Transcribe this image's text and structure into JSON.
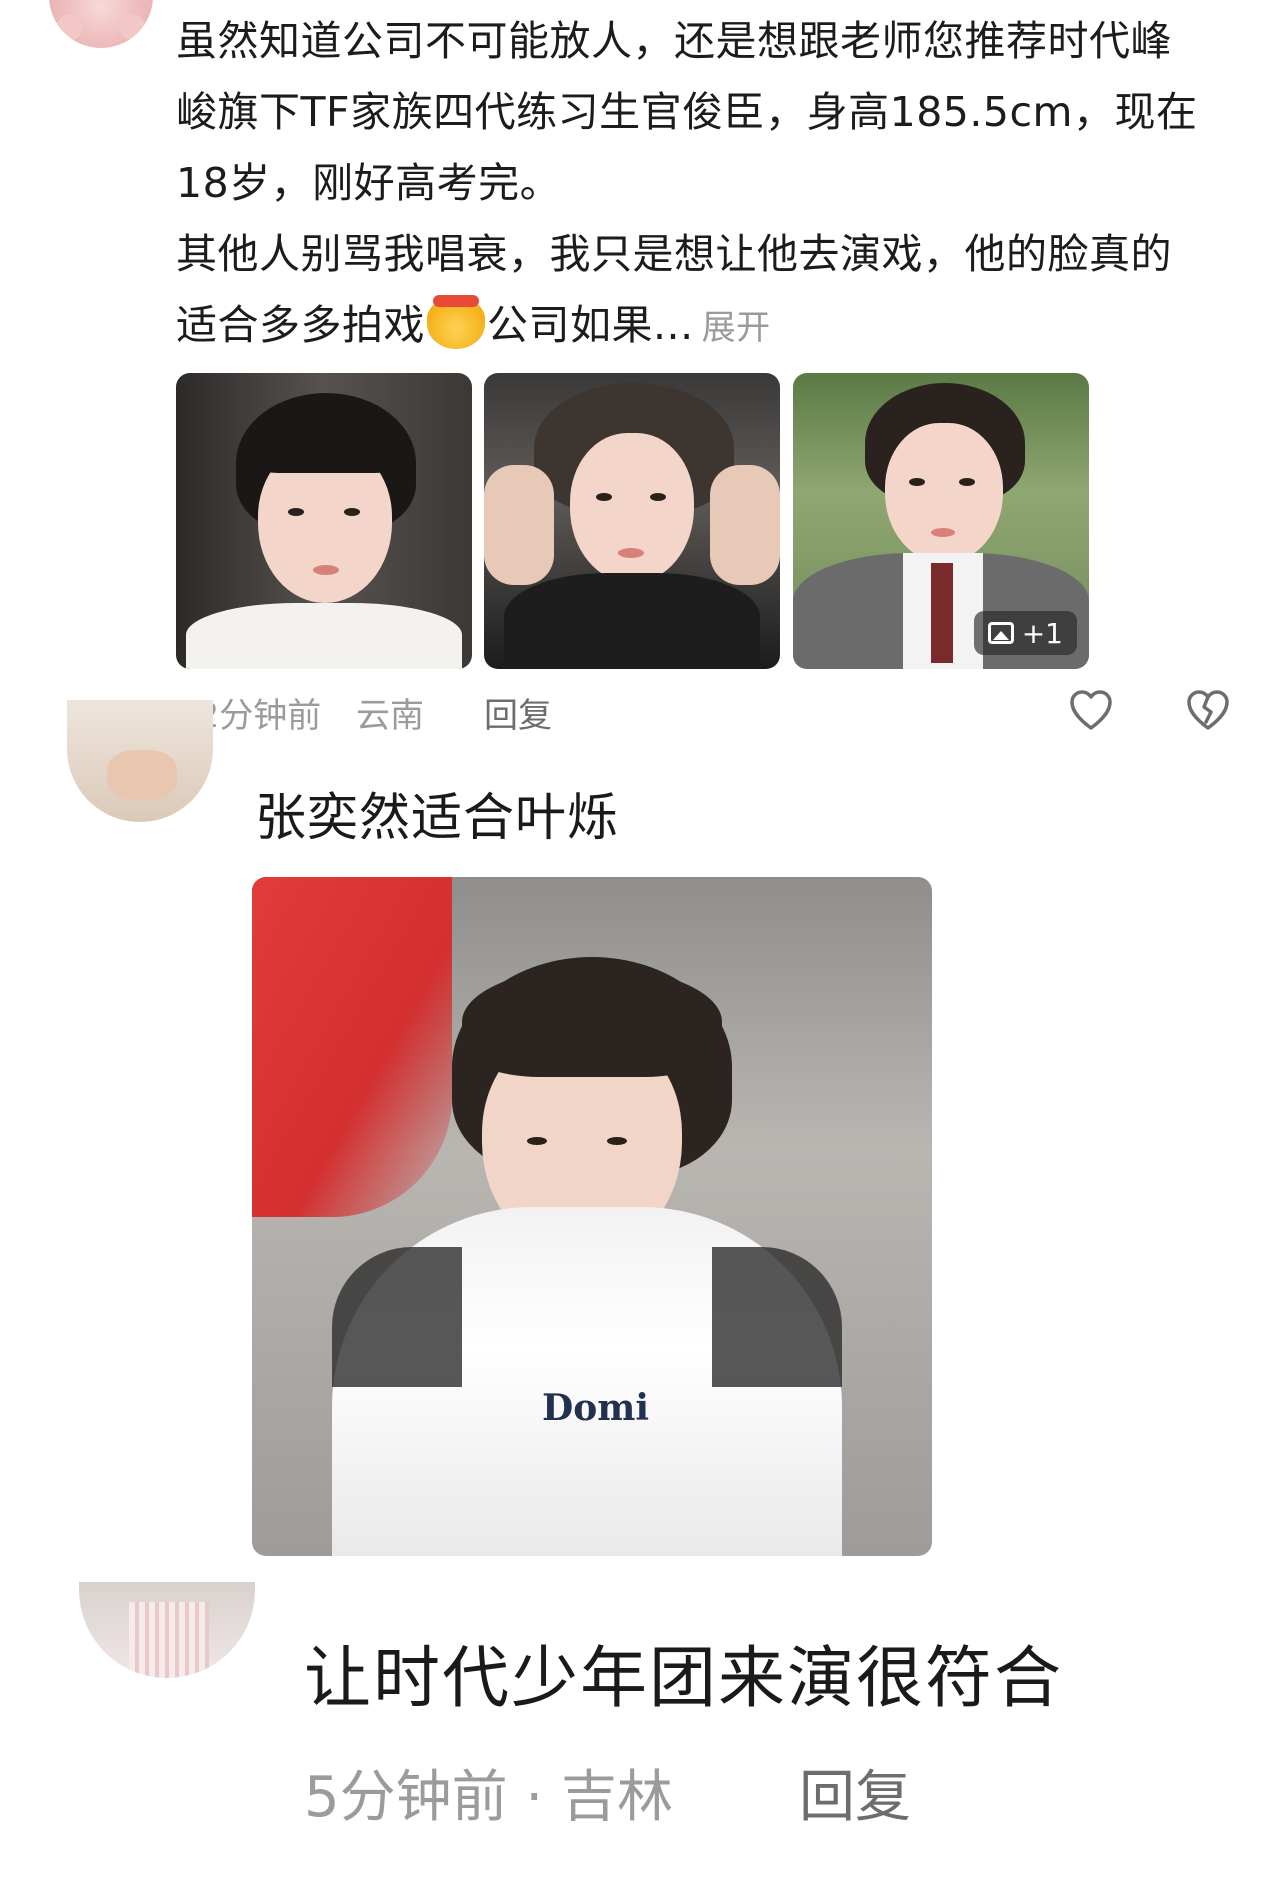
{
  "comment1": {
    "text_line1": "虽然知道公司不可能放人，还是想跟老师您推荐时代峰",
    "text_line2": "峻旗下TF家族四代练习生官俊臣，身高185.5cm，现在",
    "text_line3": "18岁，刚好高考完。",
    "text_line4": "其他人别骂我唱衰，我只是想让他去演戏，他的脸真的",
    "text_line5a": "适合多多拍戏",
    "text_line5b": "公司如果...",
    "expand": "展开",
    "more_images": "+1",
    "time": "32分钟前",
    "place": "云南",
    "reply": "回复"
  },
  "comment2": {
    "text": "张奕然适合叶烁",
    "jersey_text": "Domi"
  },
  "comment3": {
    "text": "让时代少年团来演很符合",
    "meta": "5分钟前 · 吉林",
    "reply": "回复"
  },
  "icons": {
    "like": "heart-icon",
    "dislike": "broken-heart-icon",
    "gallery": "image-icon",
    "emoji": "pray-emoji"
  },
  "colors": {
    "text": "#1c1c1c",
    "meta": "#9b9b9b",
    "reply": "#6d6d6d"
  }
}
